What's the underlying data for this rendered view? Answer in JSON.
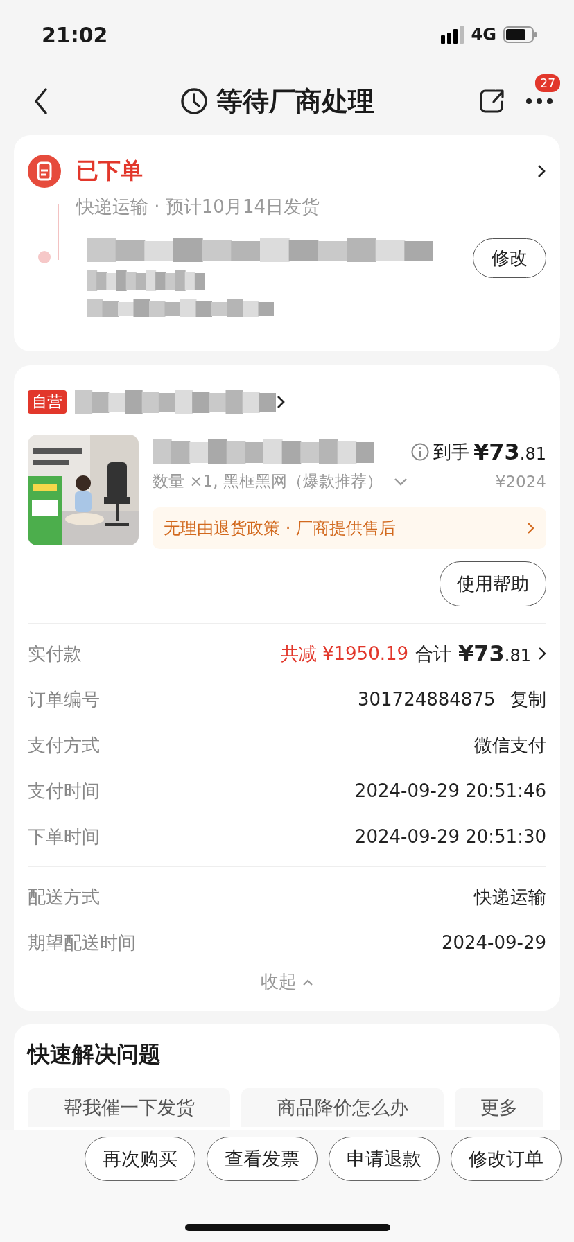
{
  "status_bar": {
    "time": "21:02",
    "network": "4G"
  },
  "nav": {
    "title": "等待厂商处理",
    "badge": "27"
  },
  "progress": {
    "status": "已下单",
    "detail": "快递运输 · 预计10月14日发货",
    "edit_button": "修改"
  },
  "order": {
    "tag": "自营",
    "product": {
      "quantity_spec": "数量 ×1, 黑框黑网（爆款推荐）",
      "net_price_label": "到手",
      "net_price": "¥73.81",
      "original_price": "¥2024"
    },
    "policy": "无理由退货政策 · 厂商提供售后",
    "help_button": "使用帮助",
    "details": [
      {
        "kind": "payment",
        "label": "实付款",
        "discount": "共减 ¥1950.19",
        "total_label": "合计",
        "total": "¥73.81"
      },
      {
        "kind": "copy",
        "label": "订单编号",
        "value": "301724884875",
        "action": "复制"
      },
      {
        "kind": "plain",
        "label": "支付方式",
        "value": "微信支付"
      },
      {
        "kind": "plain",
        "label": "支付时间",
        "value": "2024-09-29 20:51:46"
      },
      {
        "kind": "plain",
        "label": "下单时间",
        "value": "2024-09-29 20:51:30"
      }
    ],
    "delivery": [
      {
        "kind": "plain",
        "label": "配送方式",
        "value": "快递运输"
      },
      {
        "kind": "plain",
        "label": "期望配送时间",
        "value": "2024-09-29"
      }
    ],
    "collapse": "收起"
  },
  "quick": {
    "title": "快速解决问题",
    "options": [
      "帮我催一下发货",
      "商品降价怎么办",
      "更多"
    ]
  },
  "actions": [
    "再次购买",
    "查看发票",
    "申请退款",
    "修改订单"
  ]
}
